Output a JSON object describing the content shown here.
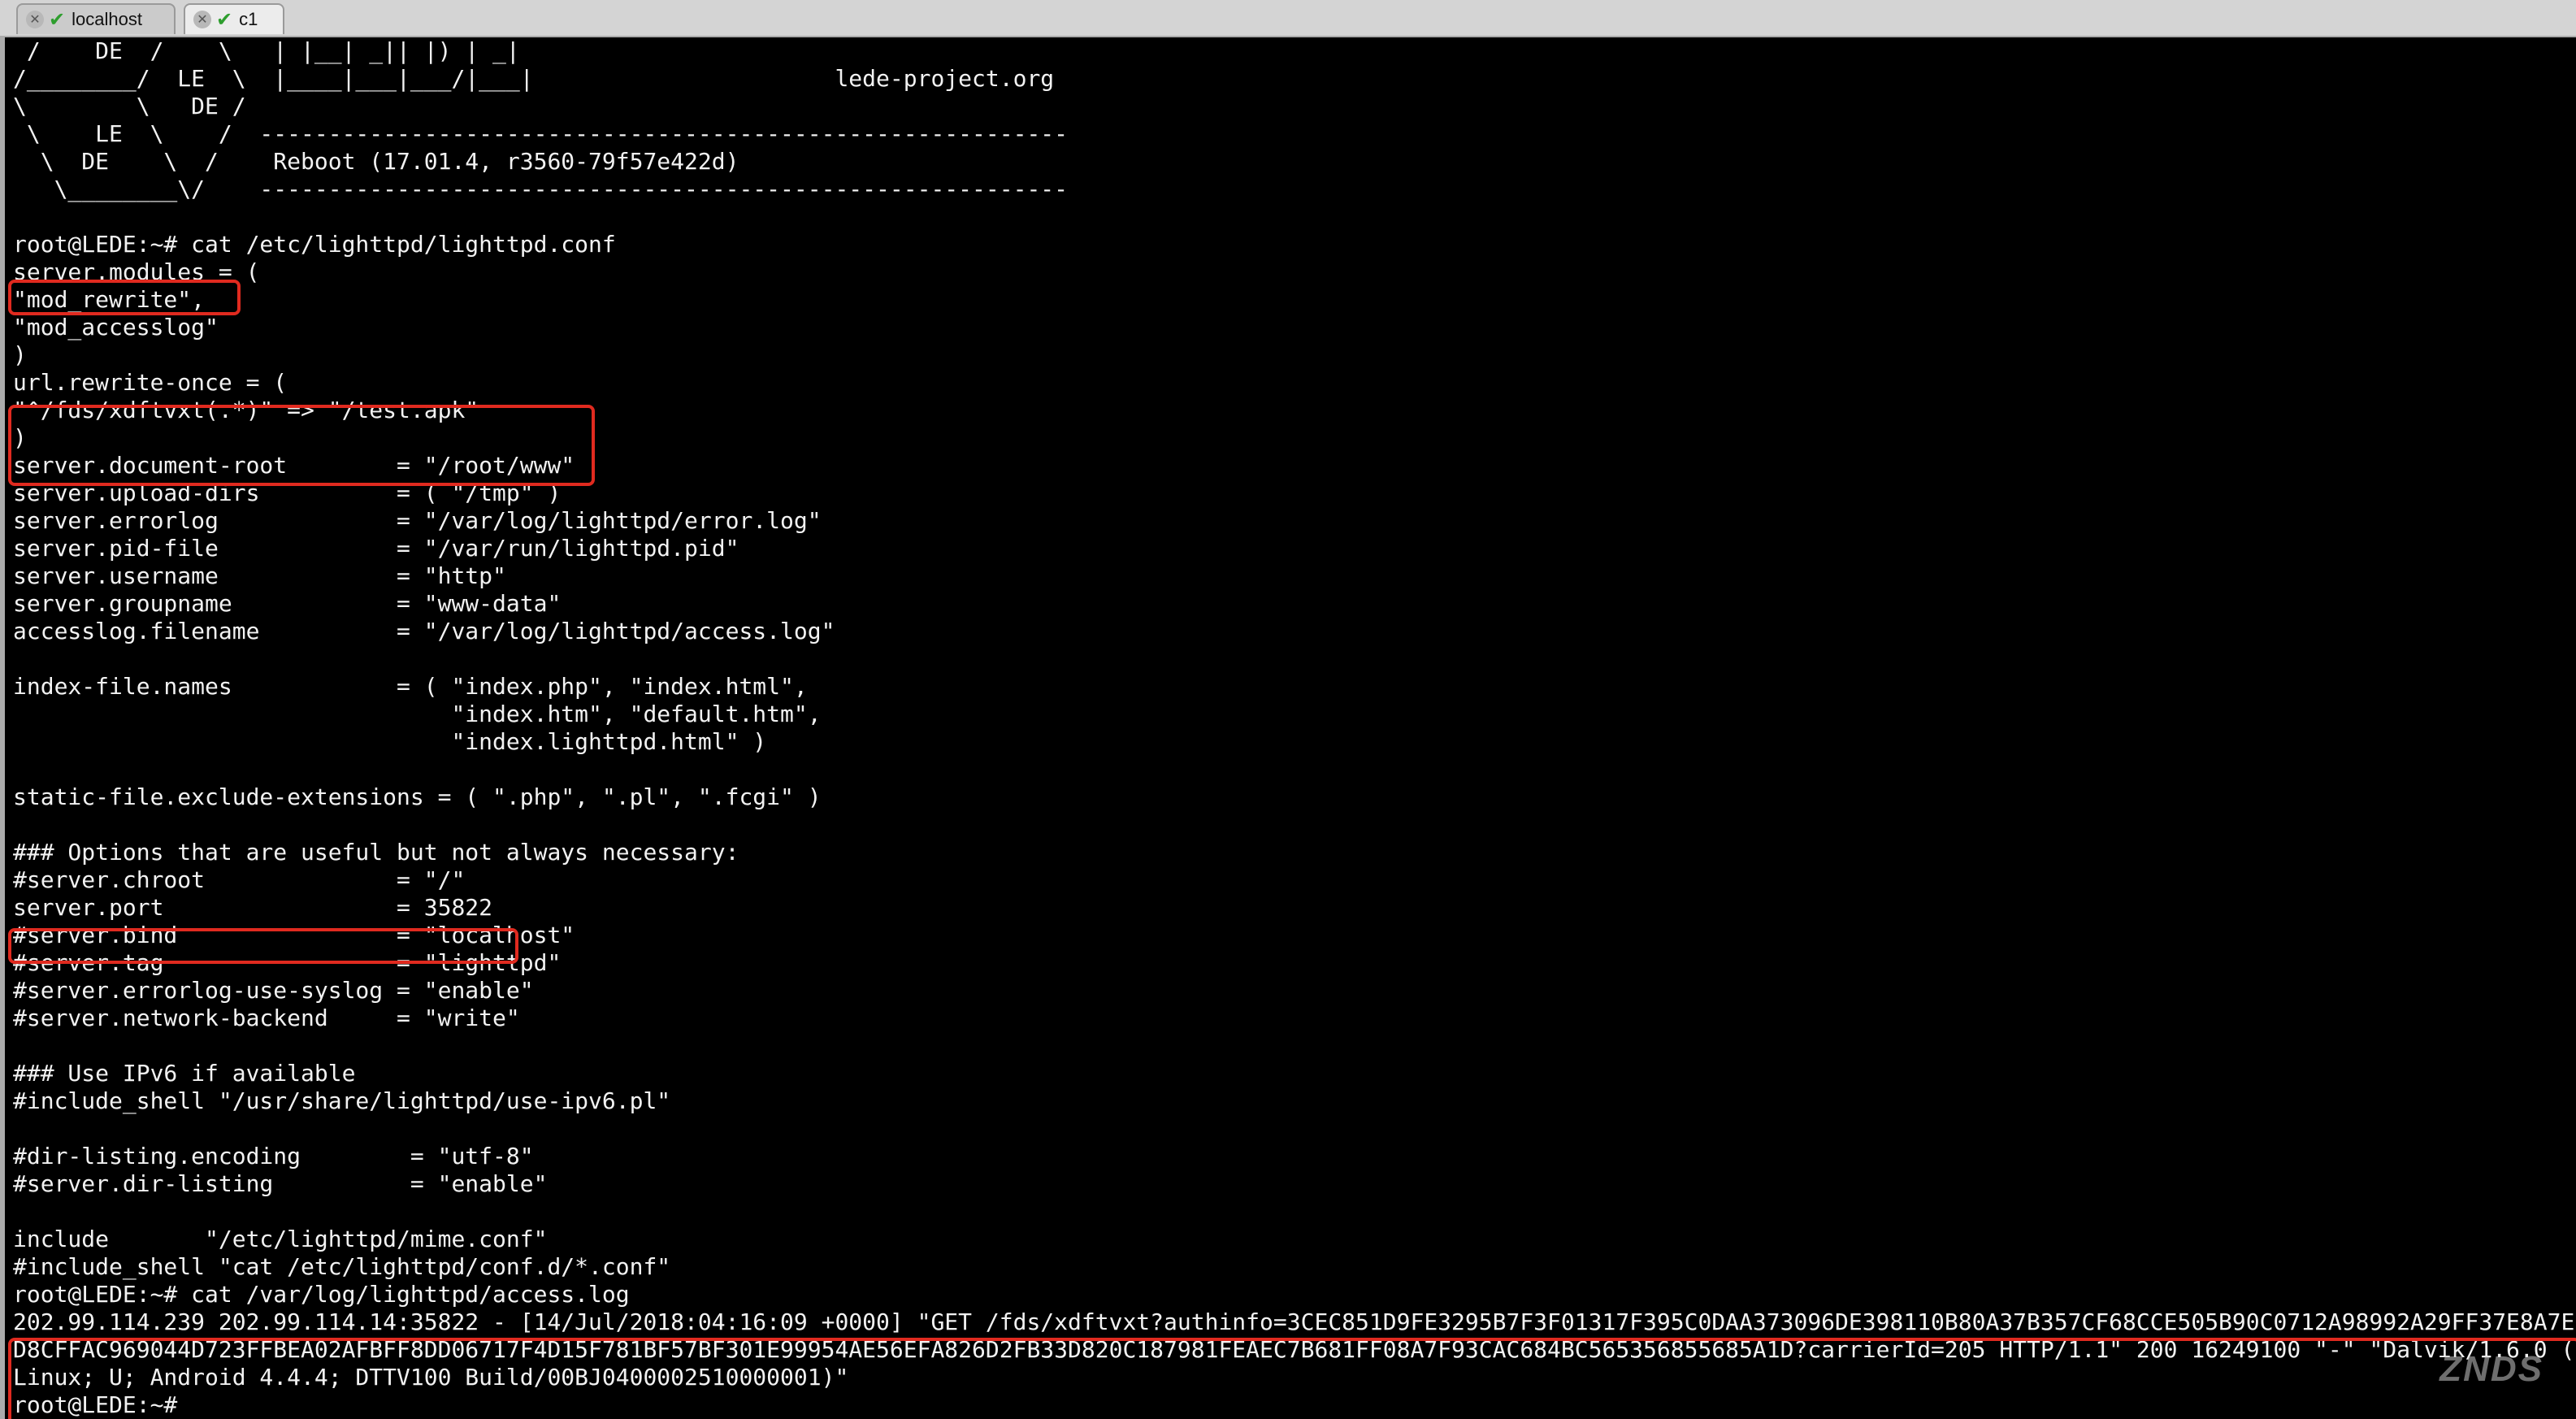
{
  "tabs": [
    {
      "label": "localhost"
    },
    {
      "label": "c1"
    }
  ],
  "terminal": {
    "lines": [
      " /    DE  /    \\   | |__| _|| |) | _|",
      "/________/  LE  \\  |____|___|___/|___|                      lede-project.org",
      "\\        \\   DE /",
      " \\    LE  \\    /  -----------------------------------------------------------",
      "  \\  DE    \\  /    Reboot (17.01.4, r3560-79f57e422d)",
      "   \\________\\/    -----------------------------------------------------------",
      "",
      "root@LEDE:~# cat /etc/lighttpd/lighttpd.conf",
      "server.modules = (",
      "\"mod_rewrite\",",
      "\"mod_accesslog\"",
      ")",
      "url.rewrite-once = (",
      "\"^/fds/xdftvxt(.*)\" => \"/test.apk\"",
      ")",
      "server.document-root        = \"/root/www\"",
      "server.upload-dirs          = ( \"/tmp\" )",
      "server.errorlog             = \"/var/log/lighttpd/error.log\"",
      "server.pid-file             = \"/var/run/lighttpd.pid\"",
      "server.username             = \"http\"",
      "server.groupname            = \"www-data\"",
      "accesslog.filename          = \"/var/log/lighttpd/access.log\"",
      "",
      "index-file.names            = ( \"index.php\", \"index.html\",",
      "                                \"index.htm\", \"default.htm\",",
      "                                \"index.lighttpd.html\" )",
      "",
      "static-file.exclude-extensions = ( \".php\", \".pl\", \".fcgi\" )",
      "",
      "### Options that are useful but not always necessary:",
      "#server.chroot              = \"/\"",
      "server.port                 = 35822",
      "#server.bind                = \"localhost\"",
      "#server.tag                 = \"lighttpd\"",
      "#server.errorlog-use-syslog = \"enable\"",
      "#server.network-backend     = \"write\"",
      "",
      "### Use IPv6 if available",
      "#include_shell \"/usr/share/lighttpd/use-ipv6.pl\"",
      "",
      "#dir-listing.encoding        = \"utf-8\"",
      "#server.dir-listing          = \"enable\"",
      "",
      "include       \"/etc/lighttpd/mime.conf\"",
      "#include_shell \"cat /etc/lighttpd/conf.d/*.conf\"",
      "root@LEDE:~# cat /var/log/lighttpd/access.log",
      "202.99.114.239 202.99.114.14:35822 - [14/Jul/2018:04:16:09 +0000] \"GET /fds/xdftvxt?authinfo=3CEC851D9FE3295B7F3F01317F395C0DAA373096DE398110B80A37B357CF68CCE505B90C0712A98992A29FF37E8A7E",
      "D8CFFAC969044D723FFBEA02AFBFF8DD06717F4D15F781BF57BF301E99954AE56EFA826D2FB33D820C187981FEAEC7B681FF08A7F93CAC684BC565356855685A1D?carrierId=205 HTTP/1.1\" 200 16249100 \"-\" \"Dalvik/1.6.0 (",
      "Linux; U; Android 4.4.4; DTTV100 Build/00BJ0400002510000001)\"",
      "root@LEDE:~#"
    ]
  },
  "watermark": "ZNDS"
}
